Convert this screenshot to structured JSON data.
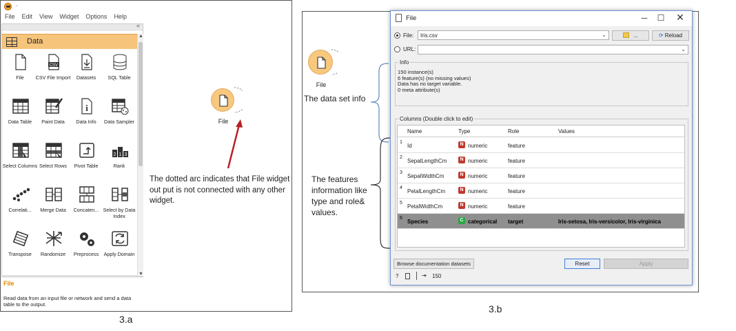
{
  "panelA": {
    "menu": [
      "File",
      "Edit",
      "View",
      "Widget",
      "Options",
      "Help"
    ],
    "title_dot": "·",
    "category": "Data",
    "collapse_glyph": "«",
    "widgets": [
      {
        "label": "File",
        "icon": "file-icon"
      },
      {
        "label": "CSV File Import",
        "icon": "csv-icon"
      },
      {
        "label": "Datasets",
        "icon": "datasets-icon"
      },
      {
        "label": "SQL Table",
        "icon": "database-icon"
      },
      {
        "label": "Data Table",
        "icon": "table-icon"
      },
      {
        "label": "Paint Data",
        "icon": "paint-icon"
      },
      {
        "label": "Data Info",
        "icon": "info-icon"
      },
      {
        "label": "Data Sampler",
        "icon": "sampler-icon"
      },
      {
        "label": "Select Columns",
        "icon": "select-columns-icon"
      },
      {
        "label": "Select Rows",
        "icon": "select-rows-icon"
      },
      {
        "label": "Pivot Table",
        "icon": "pivot-icon"
      },
      {
        "label": "Rank",
        "icon": "rank-icon"
      },
      {
        "label": "Correlati...",
        "icon": "correlations-icon"
      },
      {
        "label": "Merge Data",
        "icon": "merge-icon"
      },
      {
        "label": "Concaten...",
        "icon": "concatenate-icon"
      },
      {
        "label": "Select by Data Index",
        "icon": "select-index-icon"
      },
      {
        "label": "Transpose",
        "icon": "transpose-icon"
      },
      {
        "label": "Randomize",
        "icon": "randomize-icon"
      },
      {
        "label": "Preprocess",
        "icon": "preprocess-icon"
      },
      {
        "label": "Apply Domain",
        "icon": "apply-domain-icon"
      }
    ],
    "description_title": "File",
    "description_text": "Read data from an input file or network and send a data table to the output.",
    "canvas_widget_label": "File",
    "note": "The dotted arc indicates that File widget out put is not connected with any other widget.",
    "caption": "3.a"
  },
  "panelB": {
    "canvas_widget_label": "File",
    "info_annotation": "The data set  info",
    "features_annotation": "The  features information like type and role& values.",
    "caption": "3.b",
    "dialog": {
      "title": "File",
      "file_label": "File:",
      "file_value": "Iris.csv",
      "browse_label": "...",
      "reload_label": "Reload",
      "url_label": "URL:",
      "url_value": "",
      "info_title": "Info",
      "info_lines": [
        "150 instance(s)",
        "6 feature(s) (no missing values)",
        "Data has no target variable.",
        "0 meta attribute(s)"
      ],
      "columns_title": "Columns (Double click to edit)",
      "headers": [
        "Name",
        "Type",
        "Role",
        "Values"
      ],
      "rows": [
        {
          "num": "1",
          "name": "Id",
          "badge": "N",
          "type": "numeric",
          "role": "feature",
          "values": ""
        },
        {
          "num": "2",
          "name": "SepalLengthCm",
          "badge": "N",
          "type": "numeric",
          "role": "feature",
          "values": ""
        },
        {
          "num": "3",
          "name": "SepalWidthCm",
          "badge": "N",
          "type": "numeric",
          "role": "feature",
          "values": ""
        },
        {
          "num": "4",
          "name": "PetalLengthCm",
          "badge": "N",
          "type": "numeric",
          "role": "feature",
          "values": ""
        },
        {
          "num": "5",
          "name": "PetalWidthCm",
          "badge": "N",
          "type": "numeric",
          "role": "feature",
          "values": ""
        },
        {
          "num": "6",
          "name": "Species",
          "badge": "C",
          "type": "categorical",
          "role": "target",
          "values": "Iris-setosa, Iris-versicolor, Iris-virginica"
        }
      ],
      "browse_docs_label": "Browse documentation datasets",
      "reset_label": "Reset",
      "apply_label": "Apply",
      "status_count": "150",
      "colors": {
        "numeric_badge": "#c0392b",
        "categorical_badge": "#27a844",
        "selected_row": "#8f8f8f"
      }
    }
  }
}
